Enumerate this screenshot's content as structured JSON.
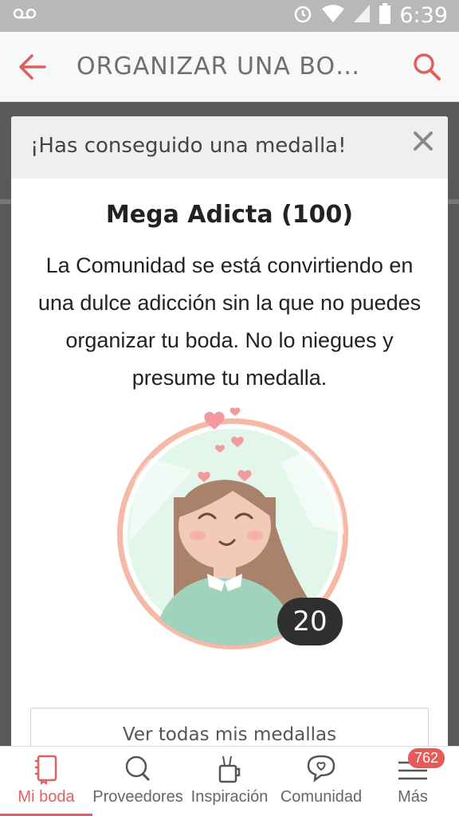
{
  "status_bar": {
    "time": "6:39",
    "icons": [
      "voicemail-icon",
      "alarm-icon",
      "wifi-icon",
      "signal-icon",
      "battery-icon"
    ]
  },
  "header": {
    "title": "ORGANIZAR UNA BO…",
    "back_icon": "back-arrow-icon",
    "search_icon": "search-icon"
  },
  "modal": {
    "title": "¡Has conseguido una medalla!",
    "close_icon": "close-icon",
    "medal_name": "Mega Adicta (100)",
    "description": "La Comunidad se está convirtiendo en una dulce adicción sin la que no puedes organizar tu boda. No lo niegues y presume tu medalla.",
    "medal_badge": "20",
    "button_label": "Ver todas mis medallas"
  },
  "bottom_nav": {
    "items": [
      {
        "label": "Mi boda",
        "icon": "notebook-icon",
        "active": true
      },
      {
        "label": "Proveedores",
        "icon": "search-icon"
      },
      {
        "label": "Inspiración",
        "icon": "cup-icon"
      },
      {
        "label": "Comunidad",
        "icon": "chat-heart-icon"
      },
      {
        "label": "Más",
        "icon": "menu-icon",
        "badge": "762"
      }
    ]
  },
  "colors": {
    "accent": "#e06060",
    "medal_ring": "#f6b9a6",
    "medal_bg": "#e2f6ec"
  }
}
